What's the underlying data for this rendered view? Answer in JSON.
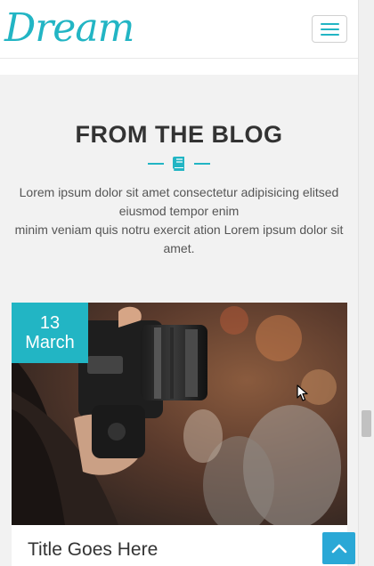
{
  "nav": {
    "logo_text": "Dream",
    "menu_icon": "hamburger-icon"
  },
  "blog_section": {
    "title": "FROM THE BLOG",
    "ornament_icon": "book-icon",
    "intro_line1": "Lorem ipsum dolor sit amet consectetur adipisicing elitsed eiusmod tempor enim",
    "intro_line2": "minim veniam quis notru exercit ation Lorem ipsum dolor sit amet."
  },
  "post": {
    "date_day": "13",
    "date_month": "March",
    "title": "Title Goes Here",
    "image_subject": "person holding a camera"
  },
  "scroll_top_icon": "chevron-up-icon",
  "colors": {
    "accent": "#22b5c4",
    "scroll_top_bg": "#2aa8d6",
    "section_bg": "#f2f2f2"
  }
}
